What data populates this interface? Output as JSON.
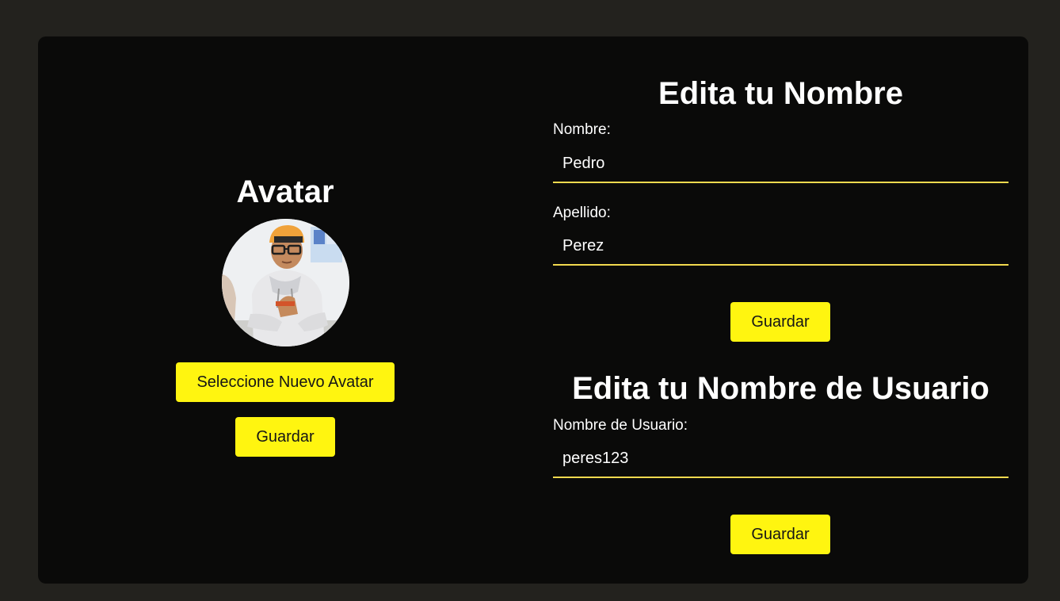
{
  "avatar": {
    "title": "Avatar",
    "select_button": "Seleccione Nuevo Avatar",
    "save_button": "Guardar"
  },
  "name_form": {
    "title": "Edita tu Nombre",
    "first_name_label": "Nombre:",
    "first_name_value": "Pedro",
    "last_name_label": "Apellido:",
    "last_name_value": "Perez",
    "save_button": "Guardar"
  },
  "username_form": {
    "title": "Edita tu Nombre de Usuario",
    "username_label": "Nombre de Usuario:",
    "username_value": "peres123",
    "save_button": "Guardar"
  },
  "colors": {
    "background": "#23221e",
    "card": "#0a0a09",
    "accent_button": "#fff510",
    "input_underline": "#f2d94e",
    "text": "#ffffff"
  }
}
